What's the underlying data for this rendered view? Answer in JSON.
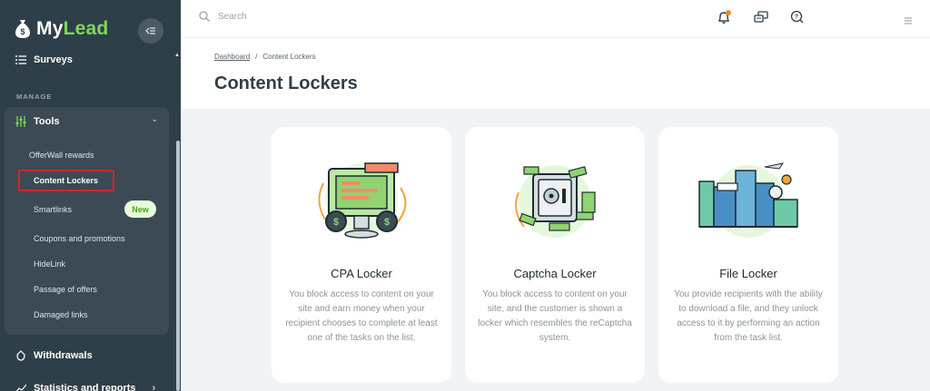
{
  "app": {
    "logo_prefix": "My",
    "logo_suffix": "Lead"
  },
  "sidebar": {
    "surveys_label": "Surveys",
    "section_label": "MANAGE",
    "tools_label": "Tools",
    "tools_items": [
      {
        "label": "OfferWall rewards"
      },
      {
        "label": "Content Lockers"
      },
      {
        "label": "Smartlinks",
        "badge": "New"
      },
      {
        "label": "Coupons and promotions"
      },
      {
        "label": "HideLink"
      },
      {
        "label": "Passage of offers"
      },
      {
        "label": "Damaged links"
      }
    ],
    "withdrawals_label": "Withdrawals",
    "stats_label": "Statistics and reports"
  },
  "header": {
    "search_placeholder": "Search",
    "icons": [
      "notification-bell-icon",
      "chat-icon",
      "support-icon",
      "menu-icon"
    ],
    "accent_color": "#f08a24"
  },
  "page": {
    "breadcrumb_home": "Dashboard",
    "breadcrumb_separator": "/",
    "breadcrumb_current": "Content Lockers",
    "title": "Content Lockers"
  },
  "cards": [
    {
      "title": "CPA Locker",
      "description": "You block access to content on your site and earn money when your recipient chooses to complete at least one of the tasks on the list."
    },
    {
      "title": "Captcha Locker",
      "description": "You block access to content on your site, and the customer is shown a locker which resembles the reCaptcha system."
    },
    {
      "title": "File Locker",
      "description": "You provide recipients with the ability to download a file, and they unlock access to it by performing an action from the task list."
    }
  ],
  "colors": {
    "sidebar_bg": "#2f3f4a",
    "brand_green": "#7ed957",
    "highlight_red": "#d8232a"
  }
}
